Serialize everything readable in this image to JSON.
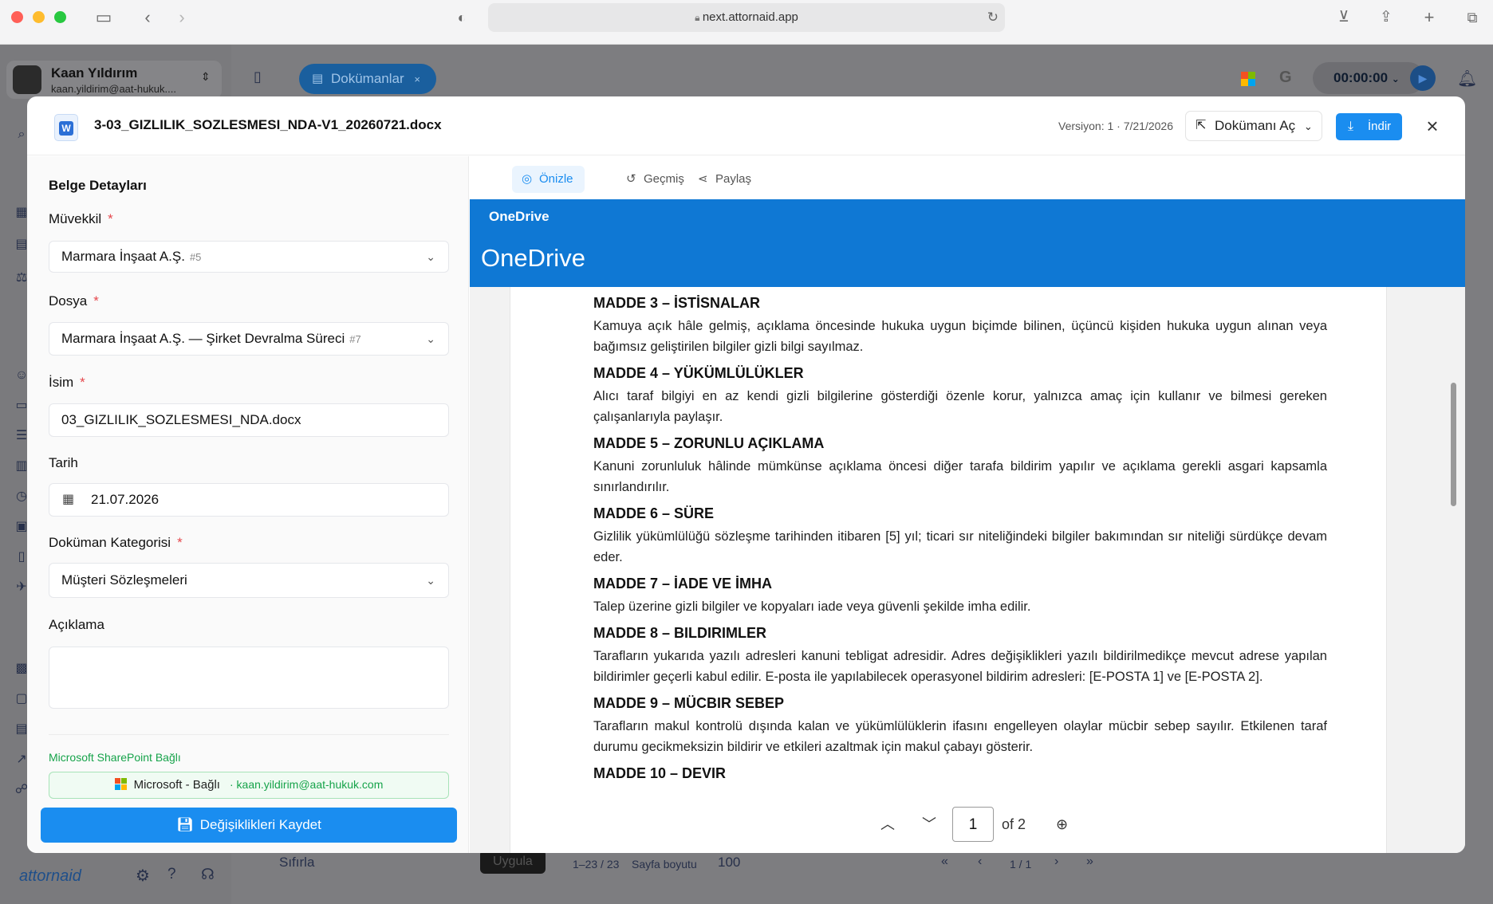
{
  "browser": {
    "url": "next.attornaid.app"
  },
  "background": {
    "user_name": "Kaan Yıldırım",
    "user_email": "kaan.yildirim@aat-hukuk....",
    "tab_label": "Dokümanlar",
    "timer": "00:00:00",
    "pagination": {
      "range": "1–23 / 23",
      "page_size_label": "Sayfa boyutu",
      "page_size": "100",
      "page_indicator": "1 / 1",
      "apply_label": "Uygula",
      "sort_label": "Sıfırla"
    },
    "brand": "attornaid"
  },
  "modal": {
    "file_name": "3-03_GIZLILIK_SOZLESMESI_NDA-V1_20260721.docx",
    "version": "Versiyon: 1 · 7/21/2026",
    "open_doc_label": "Dokümanı Aç",
    "download_label": "İndir",
    "details": {
      "title": "Belge Detayları",
      "client_label": "Müvekkil",
      "client_value": "Marmara İnşaat A.Ş.",
      "client_tag": "#5",
      "file_label": "Dosya",
      "file_value": "Marmara İnşaat A.Ş. — Şirket Devralma Süreci",
      "file_tag": "#7",
      "name_label": "İsim",
      "name_value": "03_GIZLILIK_SOZLESMESI_NDA.docx",
      "date_label": "Tarih",
      "date_value": "21.07.2026",
      "category_label": "Doküman Kategorisi",
      "category_value": "Müşteri Sözleşmeleri",
      "description_label": "Açıklama",
      "description_value": "",
      "sharepoint_label": "Microsoft SharePoint Bağlı",
      "ms_connected": "Microsoft - Bağlı",
      "ms_email": "· kaan.yildirim@aat-hukuk.com",
      "save_label": "Değişiklikleri Kaydet"
    },
    "tabs": [
      "Önizle",
      "Geçmiş",
      "Paylaş"
    ],
    "viewer": {
      "brand_small": "OneDrive",
      "brand_large": "OneDrive",
      "page_current": "1",
      "page_total": "of 2",
      "sections": [
        {
          "heading": "MADDE 3 – İSTİSNALAR",
          "text": "Kamuya açık hâle gelmiş, açıklama öncesinde hukuka uygun biçimde bilinen, üçüncü kişiden hukuka uygun alınan veya bağımsız geliştirilen bilgiler gizli bilgi sayılmaz."
        },
        {
          "heading": "MADDE 4 – YÜKÜMLÜLÜKLER",
          "text": "Alıcı taraf bilgiyi en az kendi gizli bilgilerine gösterdiği özenle korur, yalnızca amaç için kullanır ve bilmesi gereken çalışanlarıyla paylaşır."
        },
        {
          "heading": "MADDE 5 – ZORUNLU AÇIKLAMA",
          "text": "Kanuni zorunluluk hâlinde mümkünse açıklama öncesi diğer tarafa bildirim yapılır ve açıklama gerekli asgari kapsamla sınırlandırılır."
        },
        {
          "heading": "MADDE 6 – SÜRE",
          "text": "Gizlilik yükümlülüğü sözleşme tarihinden itibaren [5] yıl; ticari sır niteliğindeki bilgiler bakımından sır niteliği sürdükçe devam eder."
        },
        {
          "heading": "MADDE 7 – İADE VE İMHA",
          "text": "Talep üzerine gizli bilgiler ve kopyaları iade veya güvenli şekilde imha edilir."
        },
        {
          "heading": "MADDE 8 – BILDIRIMLER",
          "text": "Tarafların yukarıda yazılı adresleri kanuni tebligat adresidir. Adres değişiklikleri yazılı bildirilmedikçe mevcut adrese yapılan bildirimler geçerli kabul edilir. E-posta ile yapılabilecek operasyonel bildirim adresleri: [E-POSTA 1] ve [E-POSTA 2]."
        },
        {
          "heading": "MADDE 9 – MÜCBIR SEBEP",
          "text": "Tarafların makul kontrolü dışında kalan ve yükümlülüklerin ifasını engelleyen olaylar mücbir sebep sayılır. Etkilenen taraf durumu gecikmeksizin bildirir ve etkileri azaltmak için makul çabayı gösterir."
        },
        {
          "heading": "MADDE 10 – DEVIR",
          "text": ""
        }
      ]
    }
  },
  "colors": {
    "accent": "#1a8df0",
    "onedrive": "#0f78d4",
    "required": "#e5484d",
    "connected": "#16a34a"
  }
}
